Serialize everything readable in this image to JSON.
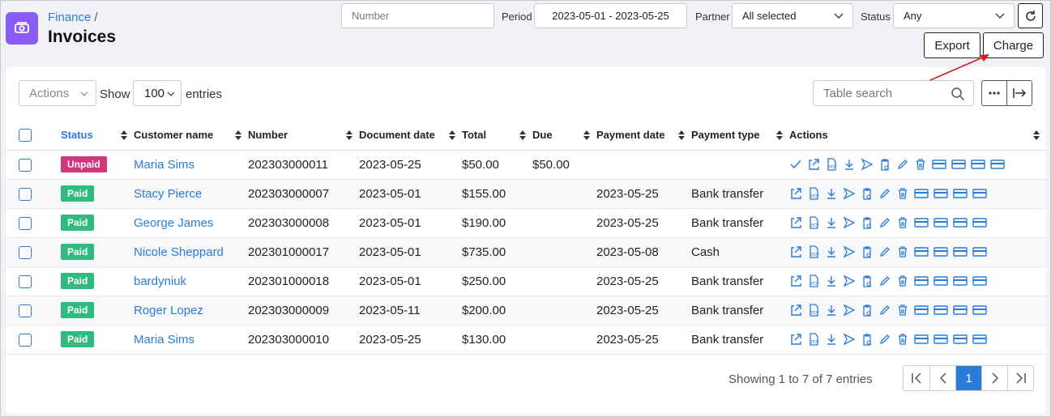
{
  "header": {
    "breadcrumb": "Finance",
    "breadcrumb_sep": "/",
    "title": "Invoices",
    "app_icon": "money-icon"
  },
  "filters": {
    "number_placeholder": "Number",
    "period_label": "Period",
    "period_value": "2023-05-01 - 2023-05-25",
    "partner_label": "Partner",
    "partner_value": "All selected",
    "status_label": "Status",
    "status_value": "Any"
  },
  "toolbar": {
    "export_label": "Export",
    "charge_label": "Charge",
    "actions_label": "Actions",
    "show_label": "Show",
    "page_length": "100",
    "entries_label": "entries",
    "table_search_placeholder": "Table search"
  },
  "table": {
    "columns": [
      "Status",
      "Customer name",
      "Number",
      "Document date",
      "Total",
      "Due",
      "Payment date",
      "Payment type",
      "Actions"
    ],
    "rows": [
      {
        "status": "Unpaid",
        "customer": "Maria Sims",
        "number": "202303000011",
        "doc_date": "2023-05-25",
        "total": "$50.00",
        "due": "$50.00",
        "pay_date": "",
        "pay_type": ""
      },
      {
        "status": "Paid",
        "customer": "Stacy Pierce",
        "number": "202303000007",
        "doc_date": "2023-05-01",
        "total": "$155.00",
        "due": "",
        "pay_date": "2023-05-25",
        "pay_type": "Bank transfer"
      },
      {
        "status": "Paid",
        "customer": "George James",
        "number": "202303000008",
        "doc_date": "2023-05-01",
        "total": "$190.00",
        "due": "",
        "pay_date": "2023-05-25",
        "pay_type": "Bank transfer"
      },
      {
        "status": "Paid",
        "customer": "Nicole Sheppard",
        "number": "202301000017",
        "doc_date": "2023-05-01",
        "total": "$735.00",
        "due": "",
        "pay_date": "2023-05-08",
        "pay_type": "Cash"
      },
      {
        "status": "Paid",
        "customer": "bardyniuk",
        "number": "202301000018",
        "doc_date": "2023-05-01",
        "total": "$250.00",
        "due": "",
        "pay_date": "2023-05-25",
        "pay_type": "Bank transfer"
      },
      {
        "status": "Paid",
        "customer": "Roger Lopez",
        "number": "202303000009",
        "doc_date": "2023-05-11",
        "total": "$200.00",
        "due": "",
        "pay_date": "2023-05-25",
        "pay_type": "Bank transfer"
      },
      {
        "status": "Paid",
        "customer": "Maria Sims",
        "number": "202303000010",
        "doc_date": "2023-05-25",
        "total": "$130.00",
        "due": "",
        "pay_date": "2023-05-25",
        "pay_type": "Bank transfer"
      }
    ]
  },
  "footer": {
    "showing_text": "Showing 1 to 7 of 7 entries",
    "current_page": "1"
  },
  "colors": {
    "accent": "#2b7bd8",
    "unpaid": "#d2367a",
    "paid": "#2fbb7d",
    "app_icon": "#8a5cf6",
    "annotation_arrow": "#d21f1f"
  }
}
